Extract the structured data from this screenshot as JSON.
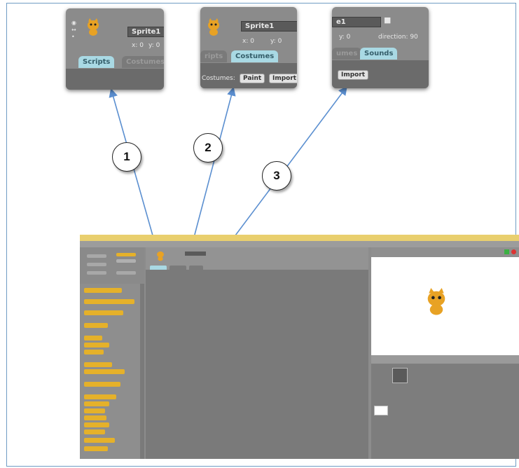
{
  "callouts": [
    {
      "number": "1"
    },
    {
      "number": "2"
    },
    {
      "number": "3"
    }
  ],
  "zoom_scripts": {
    "sprite_name": "Sprite1",
    "coord_x": "x: 0",
    "coord_y": "y: 0",
    "tab_scripts": "Scripts",
    "tab_costumes": "Costumes"
  },
  "zoom_costumes": {
    "sprite_name": "Sprite1",
    "coord_x": "x: 0",
    "coord_y": "y: 0",
    "tab_scripts": "ripts",
    "tab_costumes": "Costumes",
    "new_costume_label": "Costumes:",
    "paint_button": "Paint",
    "import_button": "Import"
  },
  "zoom_sounds": {
    "sprite_name": "e1",
    "coord_y": "y: 0",
    "direction_label": "direction: 90",
    "tab_costumes": "umes",
    "tab_sounds": "Sounds",
    "import_button": "Import"
  },
  "colors": {
    "arrow": "#5b8fd0",
    "active_tab": "#a9d9e4",
    "block": "#e5b12a",
    "title_bar": "#e9cf6e",
    "frame_border": "#6f9cc4"
  }
}
